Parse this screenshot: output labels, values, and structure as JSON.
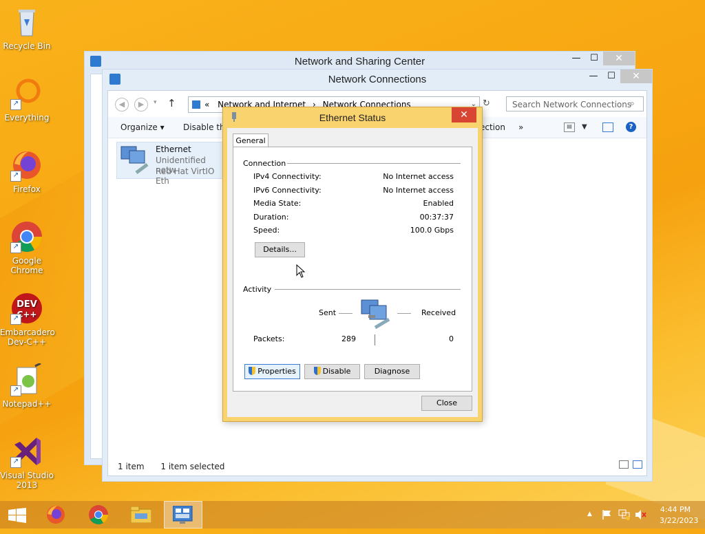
{
  "desktop": {
    "icons": [
      {
        "label": "Recycle Bin"
      },
      {
        "label": "Everything"
      },
      {
        "label": "Firefox"
      },
      {
        "label": "Google Chrome"
      },
      {
        "label": "Embarcadero Dev-C++"
      },
      {
        "label": "Notepad++"
      },
      {
        "label": "Visual Studio 2013"
      }
    ]
  },
  "nsc_window": {
    "title": "Network and Sharing Center",
    "min": "—",
    "max": "☐",
    "close": "✕"
  },
  "nc_window": {
    "title": "Network Connections",
    "min": "—",
    "max": "☐",
    "close": "✕",
    "breadcrumb": {
      "sep0": "«",
      "part1": "Network and Internet",
      "sep1": "›",
      "part2": "Network Connections"
    },
    "search_placeholder": "Search Network Connections",
    "cmd": {
      "organize": "Organize ▾",
      "disable": "Disable this",
      "connection": "ection",
      "more": "»"
    },
    "item": {
      "name": "Ethernet",
      "line1": "Unidentified netw",
      "line2": "Red Hat VirtIO Eth"
    },
    "status": {
      "count": "1 item",
      "selected": "1 item selected"
    }
  },
  "dialog": {
    "title": "Ethernet Status",
    "close": "✕",
    "tab": "General",
    "connection_heading": "Connection",
    "rows": [
      {
        "label": "IPv4 Connectivity:",
        "value": "No Internet access"
      },
      {
        "label": "IPv6 Connectivity:",
        "value": "No Internet access"
      },
      {
        "label": "Media State:",
        "value": "Enabled"
      },
      {
        "label": "Duration:",
        "value": "00:37:37"
      },
      {
        "label": "Speed:",
        "value": "100.0 Gbps"
      }
    ],
    "details_button": "Details...",
    "activity_heading": "Activity",
    "sent_label": "Sent",
    "received_label": "Received",
    "packets_label": "Packets:",
    "packets_sent": "289",
    "packets_received": "0",
    "properties_button": "Properties",
    "disable_button": "Disable",
    "diagnose_button": "Diagnose",
    "close_button": "Close"
  },
  "tray": {
    "time": "4:44 PM",
    "date": "3/22/2023",
    "arrow": "▲"
  }
}
